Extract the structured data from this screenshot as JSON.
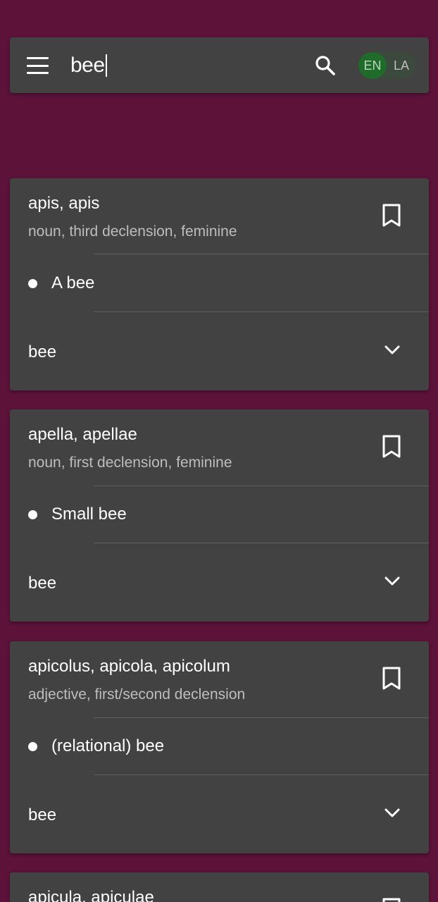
{
  "search": {
    "query": "bee",
    "languages": {
      "active": "EN",
      "inactive": "LA"
    }
  },
  "results": [
    {
      "headword": "apis, apis",
      "grammar": "noun, third declension, feminine",
      "definition": "A bee",
      "english_term": "bee"
    },
    {
      "headword": "apella, apellae",
      "grammar": "noun, first declension, feminine",
      "definition": "Small bee",
      "english_term": "bee"
    },
    {
      "headword": "apicolus, apicola, apicolum",
      "grammar": "adjective, first/second declension",
      "definition": "(relational) bee",
      "english_term": "bee"
    },
    {
      "headword": "apicula, apiculae"
    }
  ],
  "icons": {
    "menu": "menu-icon",
    "search": "search-icon",
    "bookmark": "bookmark-icon",
    "expand": "chevron-down-icon"
  },
  "colors": {
    "background": "#5c1239",
    "surface": "#424242",
    "lang_active": "#1f6b2a",
    "secondary_text": "#bdbdbd"
  }
}
